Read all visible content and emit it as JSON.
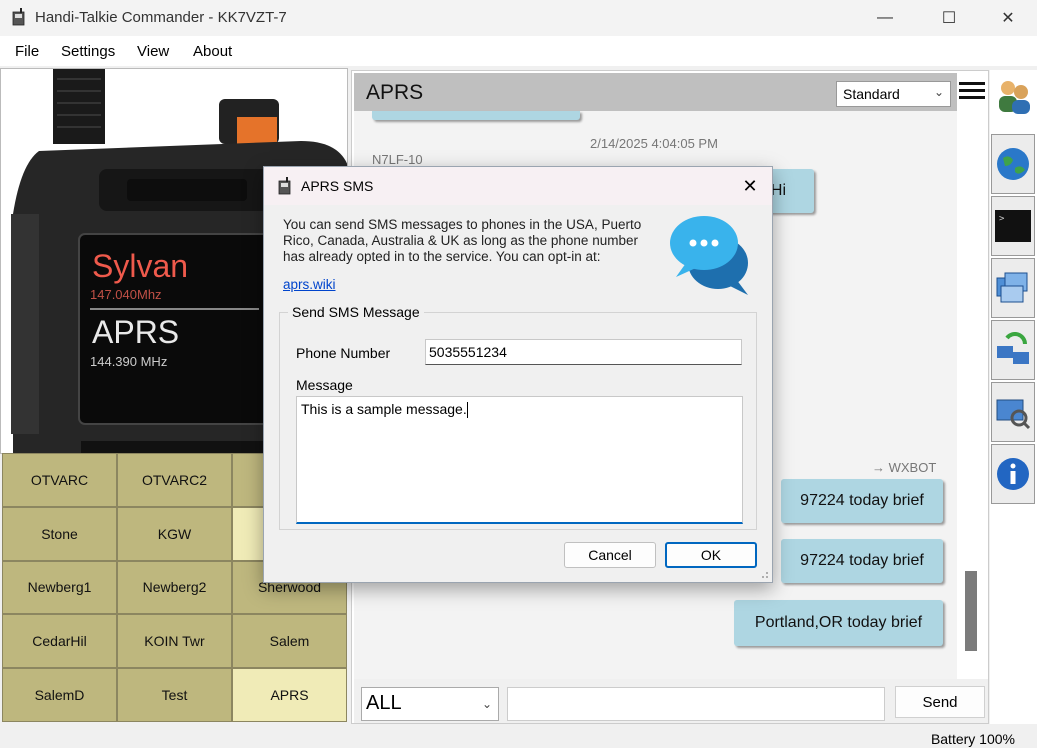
{
  "window": {
    "title": "Handi-Talkie Commander - KK7VZT-7",
    "minimize": "—",
    "maximize": "☐",
    "close": "✕"
  },
  "menu": [
    "File",
    "Settings",
    "View",
    "About"
  ],
  "radio": {
    "channel_name": "Sylvan",
    "channel_freq": "147.040Mhz",
    "mode_name": "APRS",
    "mode_freq": "144.390 MHz"
  },
  "channels": [
    {
      "label": "OTVARC",
      "selected": false
    },
    {
      "label": "OTVARC2",
      "selected": false
    },
    {
      "label": "",
      "selected": false
    },
    {
      "label": "Stone",
      "selected": false
    },
    {
      "label": "KGW",
      "selected": false
    },
    {
      "label": "",
      "selected": true
    },
    {
      "label": "Newberg1",
      "selected": false
    },
    {
      "label": "Newberg2",
      "selected": false
    },
    {
      "label": "Sherwood",
      "selected": false
    },
    {
      "label": "CedarHil",
      "selected": false
    },
    {
      "label": "KOIN Twr",
      "selected": false
    },
    {
      "label": "Salem",
      "selected": false
    },
    {
      "label": "SalemD",
      "selected": false
    },
    {
      "label": "Test",
      "selected": false
    },
    {
      "label": "APRS",
      "selected": true
    }
  ],
  "aprs": {
    "title": "APRS",
    "view_mode": "Standard",
    "messages": {
      "timestamp": "2/14/2025 4:04:05 PM",
      "sender": "N7LF-10",
      "partial_bubble": "Hi",
      "wxbot_label": "→ WXBOT",
      "bubble1": "97224 today brief",
      "bubble2": "97224 today brief",
      "bubble3": "Portland,OR today brief"
    },
    "destination": "ALL",
    "message_input": "",
    "send_label": "Send"
  },
  "sidebar_icons": [
    "users-icon",
    "globe-icon",
    "terminal-icon",
    "windows-icon",
    "network-sync-icon",
    "monitor-search-icon",
    "info-icon"
  ],
  "status": {
    "battery": "Battery 100%"
  },
  "dialog": {
    "title": "APRS SMS",
    "close": "✕",
    "description": "You can send SMS messages to phones in the USA, Puerto Rico, Canada, Australia & UK as long as the phone number has already opted in to the service. You can opt-in at:",
    "link": "aprs.wiki",
    "group_title": "Send SMS Message",
    "phone_label": "Phone Number",
    "phone_value": "5035551234",
    "message_label": "Message",
    "message_value": "This is a sample message.",
    "cancel_label": "Cancel",
    "ok_label": "OK"
  },
  "colors": {
    "channel_tile": "#beb77e",
    "channel_selected": "#f0ebb7",
    "bubble": "#aed6e2",
    "accent": "#0067c0"
  }
}
